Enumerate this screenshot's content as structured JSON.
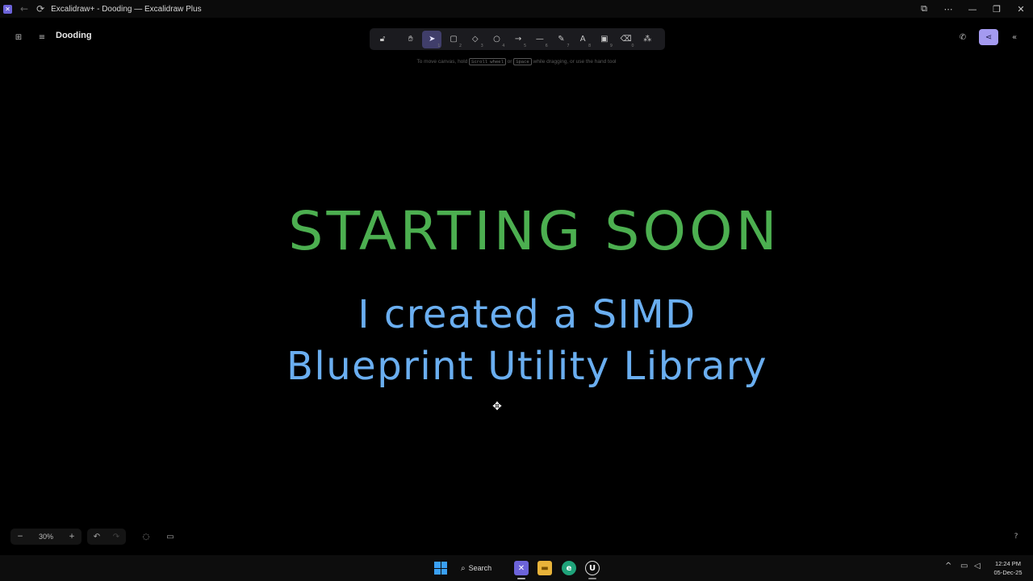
{
  "window": {
    "title": "Excalidraw+ - Dooding — Excalidraw Plus",
    "app_icon": "excalidraw-icon",
    "controls": [
      "cast-icon",
      "more-icon",
      "minimize-icon",
      "restore-icon",
      "close-icon"
    ]
  },
  "header": {
    "library_icon": "library-icon",
    "menu_icon": "hamburger-menu-icon",
    "document_name": "Dooding"
  },
  "toolbar": {
    "tools": [
      {
        "name": "lock",
        "icon": "lock-icon",
        "key": ""
      },
      {
        "name": "hand",
        "icon": "hand-icon",
        "key": ""
      },
      {
        "name": "selection",
        "icon": "pointer-icon",
        "key": "1",
        "active": true
      },
      {
        "name": "rectangle",
        "icon": "rectangle-icon",
        "key": "2"
      },
      {
        "name": "diamond",
        "icon": "diamond-icon",
        "key": "3"
      },
      {
        "name": "ellipse",
        "icon": "ellipse-icon",
        "key": "4"
      },
      {
        "name": "arrow",
        "icon": "arrow-icon",
        "key": "5"
      },
      {
        "name": "line",
        "icon": "line-icon",
        "key": "6"
      },
      {
        "name": "draw",
        "icon": "pencil-icon",
        "key": "7"
      },
      {
        "name": "text",
        "icon": "text-icon",
        "key": "8"
      },
      {
        "name": "image",
        "icon": "image-icon",
        "key": "9"
      },
      {
        "name": "eraser",
        "icon": "eraser-icon",
        "key": "0"
      },
      {
        "name": "more",
        "icon": "shapes-icon",
        "key": ""
      }
    ],
    "hint": {
      "before": "To move canvas, hold",
      "key1": "Scroll wheel",
      "middle": "or",
      "key2": "Space",
      "after": "while dragging, or use the hand tool"
    }
  },
  "top_right": {
    "call_icon": "phone-icon",
    "share_icon": "share-icon",
    "collapse_icon": "double-chevron-left-icon"
  },
  "canvas": {
    "heading": "STARTING SOON",
    "subtitle_line1": "I created a SIMD",
    "subtitle_line2": "Blueprint Utility Library",
    "heading_color": "#4caf50",
    "subtitle_color": "#6aaef0",
    "background": "#000000"
  },
  "footer": {
    "zoom_out": "−",
    "zoom_level": "30%",
    "zoom_in": "+",
    "undo_icon": "undo-icon",
    "redo_icon": "redo-icon",
    "comment_icon": "comment-icon",
    "presentation_icon": "presentation-icon",
    "help_icon": "help-icon"
  },
  "taskbar": {
    "search_label": "Search",
    "apps": [
      "excalidraw-icon",
      "file-explorer-icon",
      "edge-icon",
      "unreal-engine-icon"
    ],
    "clock_time": "12:24 PM",
    "clock_date": "05-Dec-25"
  },
  "colors": {
    "accent": "#a49af0",
    "active_tool": "#403e6a",
    "windows_blue": "#3aa0f5"
  }
}
